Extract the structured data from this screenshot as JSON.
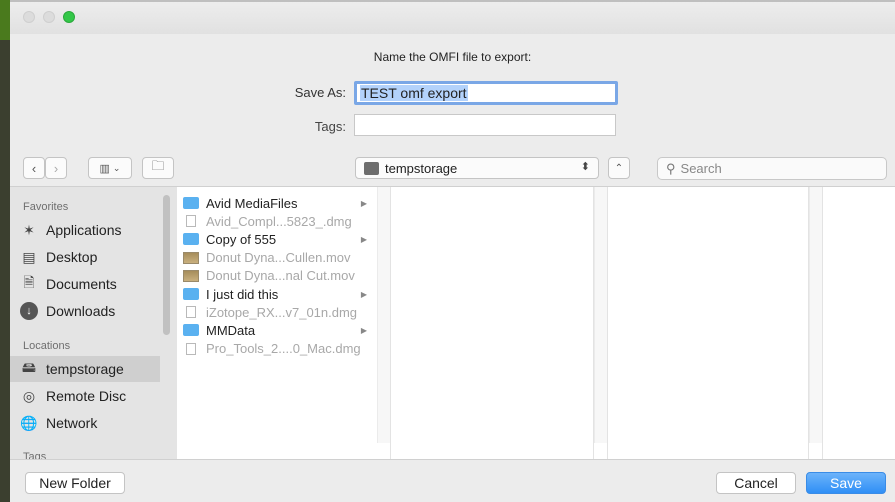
{
  "dialog": {
    "prompt": "Name the OMFI file to export:",
    "save_as_label": "Save As:",
    "save_as_value": "TEST omf export",
    "tags_label": "Tags:",
    "tags_value": ""
  },
  "toolbar": {
    "back_icon": "chevron-left-icon",
    "forward_icon": "chevron-right-icon",
    "view_icon": "column-view-icon",
    "new_folder_icon": "new-folder-icon",
    "location": "tempstorage",
    "search_placeholder": "Search"
  },
  "sidebar": {
    "favorites_header": "Favorites",
    "favorites": [
      {
        "label": "Applications",
        "icon": "applications-icon"
      },
      {
        "label": "Desktop",
        "icon": "desktop-icon"
      },
      {
        "label": "Documents",
        "icon": "documents-icon"
      },
      {
        "label": "Downloads",
        "icon": "downloads-icon"
      }
    ],
    "locations_header": "Locations",
    "locations": [
      {
        "label": "tempstorage",
        "icon": "disk-icon"
      },
      {
        "label": "Remote Disc",
        "icon": "disc-icon"
      },
      {
        "label": "Network",
        "icon": "network-icon"
      }
    ],
    "tags_header": "Tags"
  },
  "files": [
    {
      "name": "Avid MediaFiles",
      "kind": "folder",
      "enabled": true,
      "has_children": true
    },
    {
      "name": "Avid_Compl...5823_.dmg",
      "kind": "doc",
      "enabled": false,
      "has_children": false
    },
    {
      "name": "Copy of 555",
      "kind": "folder",
      "enabled": true,
      "has_children": true
    },
    {
      "name": "Donut Dyna...Cullen.mov",
      "kind": "movie",
      "enabled": false,
      "has_children": false
    },
    {
      "name": "Donut Dyna...nal Cut.mov",
      "kind": "movie",
      "enabled": false,
      "has_children": false
    },
    {
      "name": "I just did this",
      "kind": "folder",
      "enabled": true,
      "has_children": true
    },
    {
      "name": "iZotope_RX...v7_01n.dmg",
      "kind": "doc",
      "enabled": false,
      "has_children": false
    },
    {
      "name": "MMData",
      "kind": "folder",
      "enabled": true,
      "has_children": true
    },
    {
      "name": "Pro_Tools_2....0_Mac.dmg",
      "kind": "doc",
      "enabled": false,
      "has_children": false
    }
  ],
  "buttons": {
    "new_folder": "New Folder",
    "cancel": "Cancel",
    "save": "Save"
  }
}
